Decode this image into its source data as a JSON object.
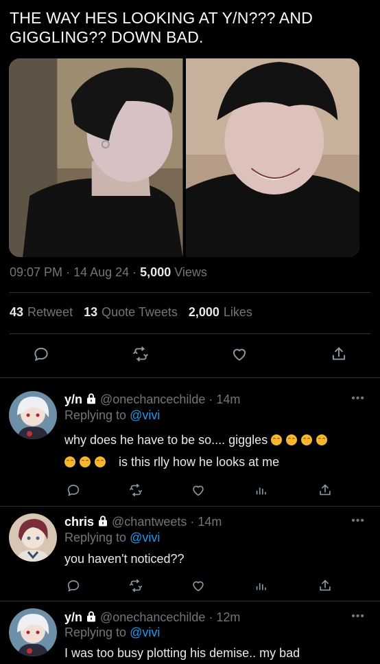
{
  "tweet": {
    "text": "THE WAY HES LOOKING AT Y/N??? AND GIGGLING?? DOWN BAD.",
    "time": "09:07 PM",
    "date": "14 Aug 24",
    "views_count": "5,000",
    "views_label": "Views",
    "retweets_count": "43",
    "retweets_label": "Retweet",
    "quotes_count": "13",
    "quotes_label": "Quote Tweets",
    "likes_count": "2,000",
    "likes_label": "Likes"
  },
  "replies": [
    {
      "name": "y/n",
      "handle": "@onechancechilde",
      "time": "14m",
      "replying_prefix": "Replying to",
      "mention": "@vivi",
      "text_line1": "why does he have to be so.... giggles",
      "text_line2": "is this rlly how he looks at me",
      "emoji_name": "smiling-face-icon"
    },
    {
      "name": "chris",
      "handle": "@chantweets",
      "time": "14m",
      "replying_prefix": "Replying to",
      "mention": "@vivi",
      "text_line1": "you haven't noticed??"
    },
    {
      "name": "y/n",
      "handle": "@onechancechilde",
      "time": "12m",
      "replying_prefix": "Replying to",
      "mention": "@vivi",
      "text_line1": "I was too busy plotting his demise.. my bad"
    }
  ],
  "more_label": "•••",
  "colors": {
    "accent": "#1d9bf0",
    "muted": "#71767b",
    "divider": "#2f3336"
  }
}
